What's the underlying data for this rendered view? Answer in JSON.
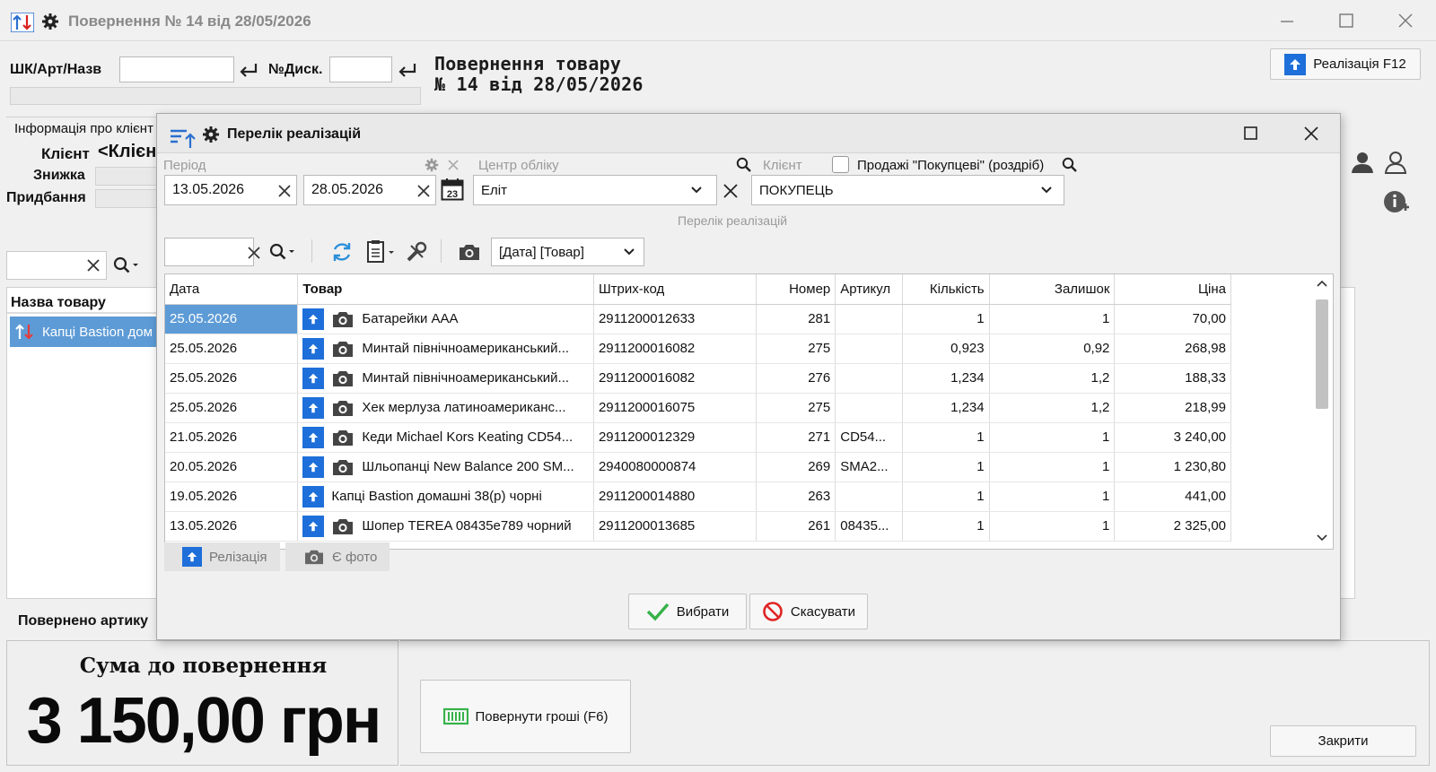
{
  "window": {
    "title": "Повернення № 14 від 28/05/2026"
  },
  "search": {
    "barcode_label": "ШК/Арт/Назв",
    "barcode_value": "",
    "disc_label": "№Диск.",
    "disc_value": ""
  },
  "header": {
    "line1": "Повернення товару",
    "line2": "№ 14 від 28/05/2026",
    "sales_button": "Реалізація F12"
  },
  "client_info": {
    "group_label": "Інформація про клієнт",
    "client_label": "Клієнт",
    "client_value": "<Клієн",
    "discount_label": "Знижка",
    "purchase_label": "Придбання"
  },
  "left_list": {
    "header": "Назва товару",
    "item": "Капці Bastion дом"
  },
  "returned_label": "Повернено артику",
  "totals": {
    "caption": "Сума до повернення",
    "amount": "3 150,00 грн"
  },
  "actions": {
    "refund": "Повернути гроші (F6)",
    "close": "Закрити"
  },
  "dialog": {
    "title": "Перелік реалізацій",
    "period_label": "Період",
    "date_from": "13.05.2026",
    "date_to": "28.05.2026",
    "calendar_day": "23",
    "center_label": "Центр обліку",
    "center_value": "Еліт",
    "client_label": "Клієнт",
    "retail_checkbox_label": "Продажі \"Покупцеві\" (роздріб)",
    "retail_checked": false,
    "client_value": "ПОКУПЕЦЬ",
    "section_caption": "Перелік реалізацій",
    "sort_value": "[Дата]  [Товар]",
    "columns": [
      "Дата",
      "Товар",
      "Штрих-код",
      "Номер",
      "Артикул",
      "Кількість",
      "Залишок",
      "Ціна"
    ],
    "rows": [
      {
        "date": "25.05.2026",
        "photo": true,
        "name": "Батарейки ААА",
        "barcode": "2911200012633",
        "number": "281",
        "article": "",
        "qty": "1",
        "rest": "1",
        "price": "70,00"
      },
      {
        "date": "25.05.2026",
        "photo": true,
        "name": "Минтай північноамериканський...",
        "barcode": "2911200016082",
        "number": "275",
        "article": "",
        "qty": "0,923",
        "rest": "0,92",
        "price": "268,98"
      },
      {
        "date": "25.05.2026",
        "photo": true,
        "name": "Минтай північноамериканський...",
        "barcode": "2911200016082",
        "number": "276",
        "article": "",
        "qty": "1,234",
        "rest": "1,2",
        "price": "188,33"
      },
      {
        "date": "25.05.2026",
        "photo": true,
        "name": "Хек мерлуза латиноамериканс...",
        "barcode": "2911200016075",
        "number": "275",
        "article": "",
        "qty": "1,234",
        "rest": "1,2",
        "price": "218,99"
      },
      {
        "date": "21.05.2026",
        "photo": true,
        "name": "Кеди Michael Kors Keating CD54...",
        "barcode": "2911200012329",
        "number": "271",
        "article": "CD54...",
        "qty": "1",
        "rest": "1",
        "price": "3 240,00"
      },
      {
        "date": "20.05.2026",
        "photo": true,
        "name": "Шльопанці New Balance 200 SM...",
        "barcode": "2940080000874",
        "number": "269",
        "article": "SMA2...",
        "qty": "1",
        "rest": "1",
        "price": "1 230,80"
      },
      {
        "date": "19.05.2026",
        "photo": false,
        "name": "Капці Bastion домашні 38(р) чорні",
        "barcode": "2911200014880",
        "number": "263",
        "article": "",
        "qty": "1",
        "rest": "1",
        "price": "441,00"
      },
      {
        "date": "13.05.2026",
        "photo": true,
        "name": "Шопер TEREA 08435e789 чорний",
        "barcode": "2911200013685",
        "number": "261",
        "article": "08435...",
        "qty": "1",
        "rest": "1",
        "price": "2 325,00"
      }
    ],
    "legend_sale": "Релізація",
    "legend_photo": "Є фото",
    "select_button": "Вибрати",
    "cancel_button": "Скасувати"
  },
  "colors": {
    "accent_blue": "#1e6fd9",
    "selected_row": "#5d9bd6",
    "green_check": "#36b24a",
    "cancel_red": "#e02424"
  }
}
